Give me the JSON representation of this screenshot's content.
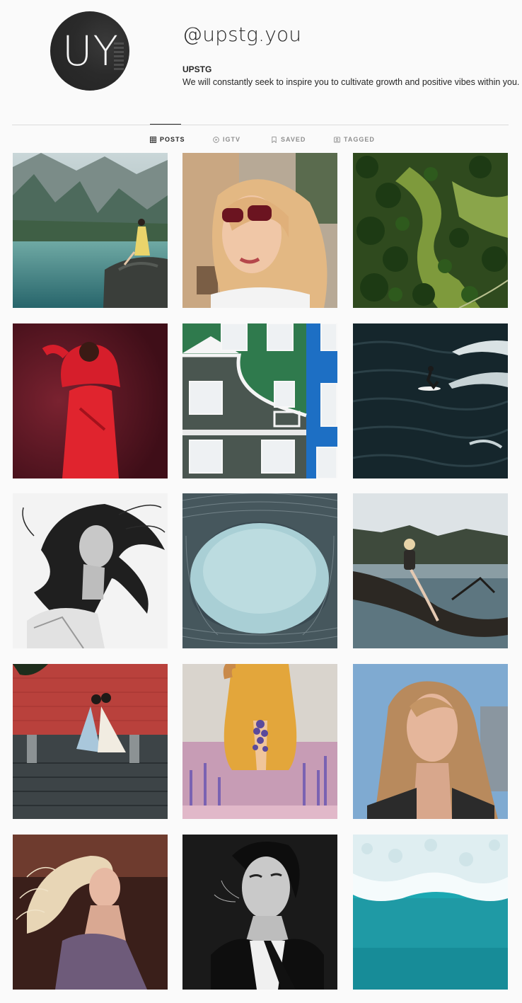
{
  "profile": {
    "avatar_text": "UY",
    "username": "@upstg.you",
    "full_name": "UPSTG",
    "bio": "We will constantly seek to inspire you to cultivate growth and positive vibes within you."
  },
  "tabs": [
    {
      "label": "POSTS",
      "icon": "grid-icon",
      "active": true
    },
    {
      "label": "IGTV",
      "icon": "play-circle-icon",
      "active": false
    },
    {
      "label": "SAVED",
      "icon": "bookmark-icon",
      "active": false
    },
    {
      "label": "TAGGED",
      "icon": "tag-person-icon",
      "active": false
    }
  ],
  "posts": [
    {
      "subject": "woman sitting on rock by mountain lake"
    },
    {
      "subject": "blonde woman in red sunglasses"
    },
    {
      "subject": "aerial view of forest"
    },
    {
      "subject": "woman in red dress on red background"
    },
    {
      "subject": "colorful building facades"
    },
    {
      "subject": "surfer on dark ocean waves"
    },
    {
      "subject": "black and white woman with flowing hair"
    },
    {
      "subject": "architectural ring looking up at sky"
    },
    {
      "subject": "woman sitting on tree trunk over lake"
    },
    {
      "subject": "couple in traditional dress on steps by red wall"
    },
    {
      "subject": "woman in yellow dress holding lavender"
    },
    {
      "subject": "young woman with long hair outdoors"
    },
    {
      "subject": "blonde woman with windblown hair"
    },
    {
      "subject": "woman in suit smoking in black and white"
    },
    {
      "subject": "aerial view of turquoise ocean waves"
    }
  ],
  "colors": {
    "background": "#fafafa",
    "text": "#262626",
    "muted": "#8e8e8e",
    "divider": "#dbdbdb",
    "avatar": "#2a2a2a"
  }
}
